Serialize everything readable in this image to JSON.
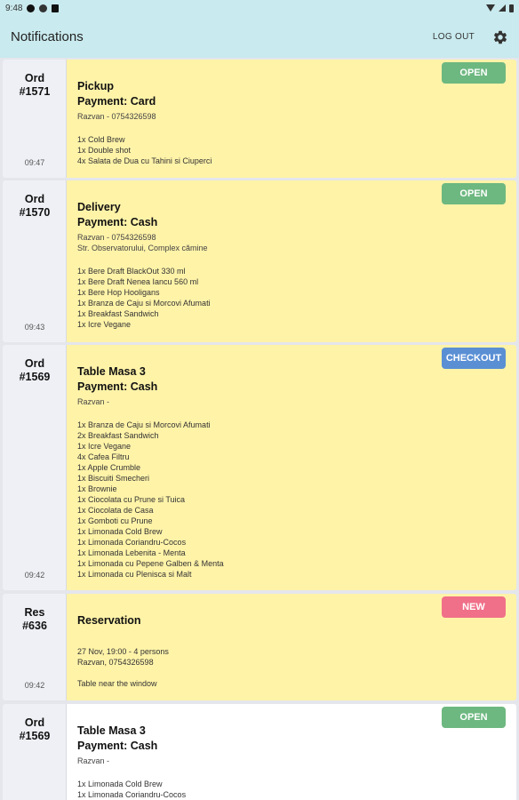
{
  "status_bar": {
    "time": "9:48"
  },
  "app_bar": {
    "title": "Notifications",
    "logout_label": "LOG OUT"
  },
  "cards": [
    {
      "id": "Ord\n#1571",
      "time": "09:47",
      "status": "OPEN",
      "title": "Pickup",
      "payment": "Payment: Card",
      "lines": [
        "Razvan - 0754326598"
      ],
      "items": [
        "1x Cold Brew",
        "1x Double shot",
        "4x Salata de Dua cu Tahini si Ciuperci"
      ]
    },
    {
      "id": "Ord\n#1570",
      "time": "09:43",
      "status": "OPEN",
      "title": "Delivery",
      "payment": "Payment: Cash",
      "lines": [
        "Razvan - 0754326598",
        "Str. Observatorului, Complex cămine"
      ],
      "items": [
        "1x Bere Draft BlackOut 330 ml",
        "1x Bere Draft Nenea Iancu 560 ml",
        "1x Bere Hop Hooligans",
        "1x Branza de Caju si Morcovi Afumati",
        "1x Breakfast Sandwich",
        "1x Icre Vegane"
      ]
    },
    {
      "id": "Ord\n#1569",
      "time": "09:42",
      "status": "CHECKOUT",
      "title": "Table Masa 3",
      "payment": "Payment: Cash",
      "lines": [
        "Razvan -"
      ],
      "items": [
        "1x Branza de Caju si Morcovi Afumati",
        "2x Breakfast Sandwich",
        "1x Icre Vegane",
        "4x Cafea Filtru",
        "1x Apple Crumble",
        "1x Biscuiti Smecheri",
        "1x Brownie",
        "1x Ciocolata cu Prune si Tuica",
        "1x Ciocolata de Casa",
        "1x Gomboti cu Prune",
        "1x Limonada Cold Brew",
        "1x Limonada Coriandru-Cocos",
        "1x Limonada Lebenita - Menta",
        "1x Limonada cu Pepene Galben & Menta",
        "1x Limonada cu Plenisca si Malt"
      ]
    },
    {
      "id": "Res\n#636",
      "time": "09:42",
      "status": "NEW",
      "title": "Reservation",
      "payment": "",
      "lines": [],
      "items": [
        "27 Nov, 19:00 - 4 persons",
        "Razvan, 0754326598",
        "",
        "Table near the window"
      ]
    },
    {
      "id": "Ord\n#1569",
      "time": "",
      "status": "OPEN",
      "title": "Table Masa 3",
      "payment": "Payment: Cash",
      "lines": [
        "Razvan -"
      ],
      "items": [
        "1x Limonada Cold Brew",
        "1x Limonada Coriandru-Cocos"
      ]
    }
  ]
}
